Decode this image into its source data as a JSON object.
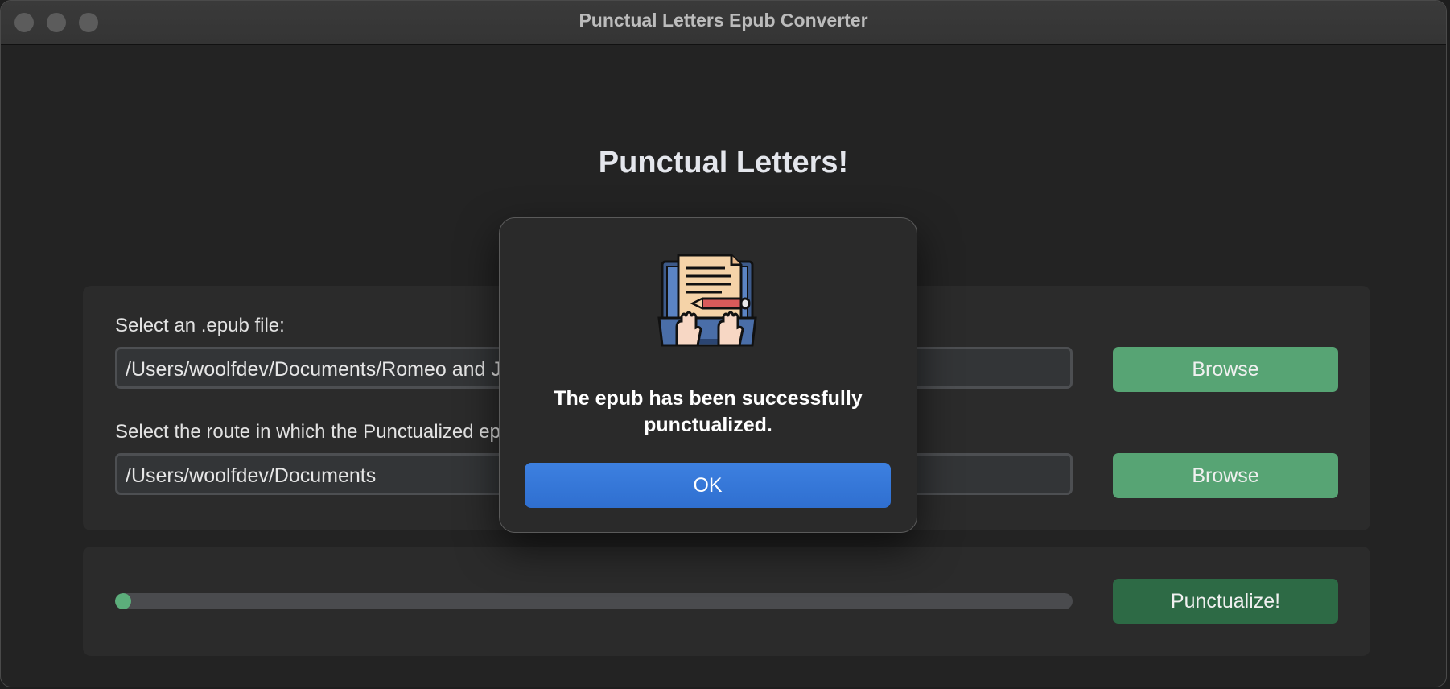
{
  "window": {
    "title": "Punctual Letters Epub Converter"
  },
  "app": {
    "heading": "Punctual Letters!"
  },
  "file_panel": {
    "epub_label": "Select an .epub file:",
    "epub_path": "/Users/woolfdev/Documents/Romeo and Juliet.epub",
    "route_label": "Select the route in which the Punctualized epub will be saved:",
    "route_path": "/Users/woolfdev/Documents",
    "browse_label": "Browse"
  },
  "progress_panel": {
    "progress_fraction": 0.01,
    "punctualize_label": "Punctualize!"
  },
  "dialog": {
    "icon": "writing-laptop-icon",
    "message": "The epub has been successfully punctualized.",
    "ok_label": "OK"
  },
  "colors": {
    "browse_green": "#57a474",
    "punctualize_green": "#2d6a45",
    "ok_blue": "#3176d9",
    "progress_green": "#5cae7b"
  }
}
